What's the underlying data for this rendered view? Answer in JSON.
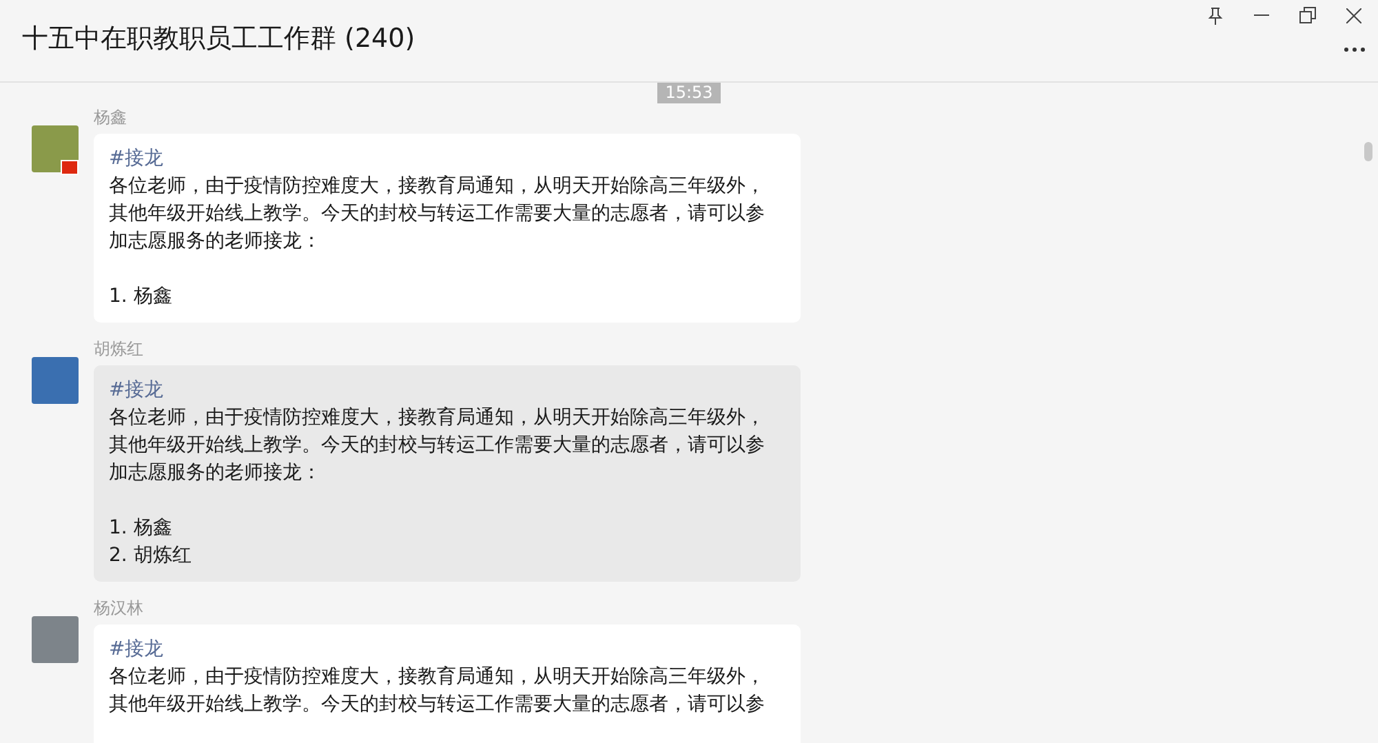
{
  "window": {
    "title": "十五中在职教职员工工作群 (240)"
  },
  "time_divider": "15:53",
  "messages": [
    {
      "sender": "杨鑫",
      "avatar_badge": true,
      "highlighted": false,
      "tag": "#接龙",
      "body": "各位老师，由于疫情防控难度大，接教育局通知，从明天开始除高三年级外，其他年级开始线上教学。今天的封校与转运工作需要大量的志愿者，请可以参加志愿服务的老师接龙：",
      "entries": [
        "1. 杨鑫"
      ]
    },
    {
      "sender": "胡炼红",
      "avatar_badge": false,
      "highlighted": true,
      "tag": "#接龙",
      "body": "各位老师，由于疫情防控难度大，接教育局通知，从明天开始除高三年级外，其他年级开始线上教学。今天的封校与转运工作需要大量的志愿者，请可以参加志愿服务的老师接龙：",
      "entries": [
        "1. 杨鑫",
        "2. 胡炼红"
      ]
    },
    {
      "sender": "杨汉林",
      "avatar_badge": false,
      "highlighted": false,
      "tag": "#接龙",
      "body": "各位老师，由于疫情防控难度大，接教育局通知，从明天开始除高三年级外，其他年级开始线上教学。今天的封校与转运工作需要大量的志愿者，请可以参"
    }
  ]
}
